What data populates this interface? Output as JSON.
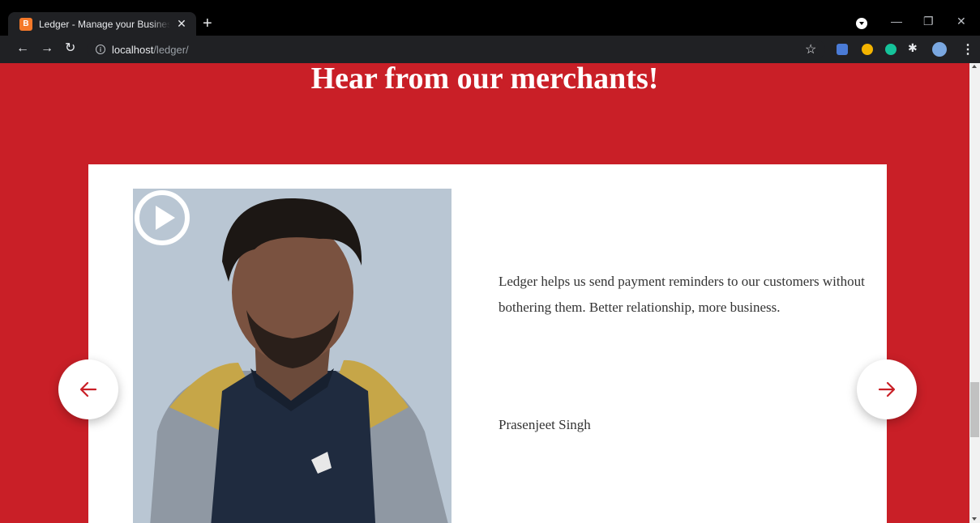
{
  "browser": {
    "tab_title": "Ledger - Manage your Business & ...",
    "tab_favicon_text": "B",
    "new_tab_label": "+",
    "url_host": "localhost",
    "url_path": "/ledger/"
  },
  "page": {
    "heading": "Hear from our merchants!",
    "testimonial": {
      "quote": "Ledger helps us send payment reminders to our customers without bothering them. Better relationship, more business.",
      "author": "Prasenjeet Singh"
    }
  },
  "colors": {
    "brand_red": "#c91f27",
    "card_bg": "#ffffff",
    "photo_bg": "#b9c6d3"
  },
  "icons": {
    "prev": "arrow-left-icon",
    "next": "arrow-right-icon",
    "play": "play-icon"
  }
}
